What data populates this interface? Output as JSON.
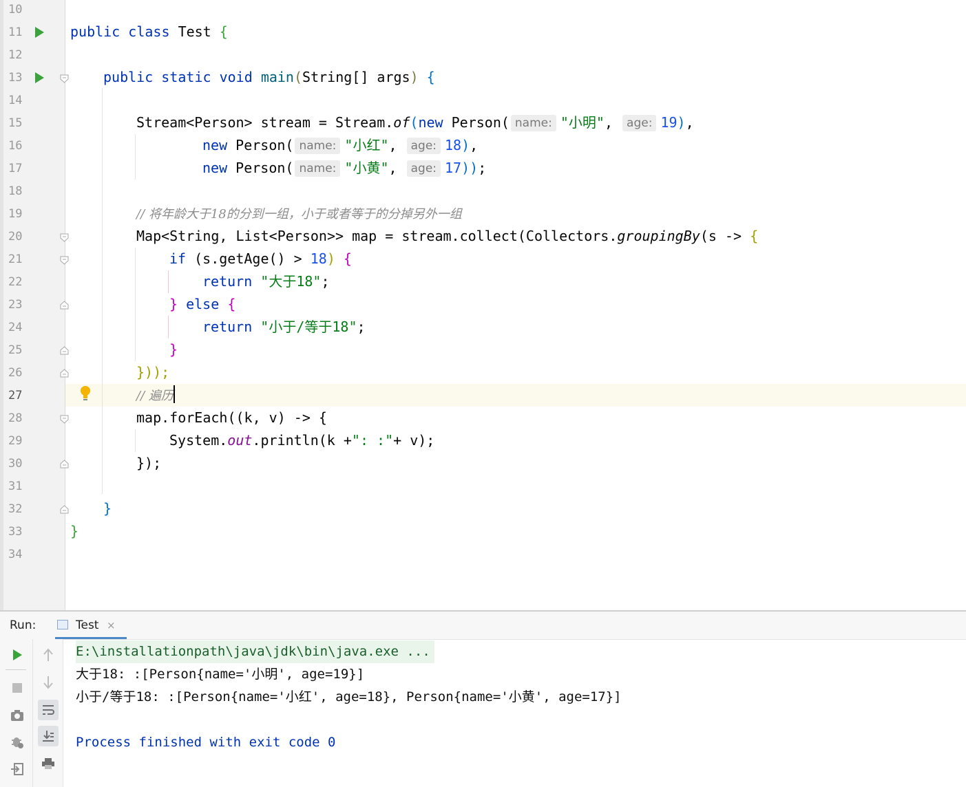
{
  "line_numbers": [
    "10",
    "11",
    "12",
    "13",
    "14",
    "15",
    "16",
    "17",
    "18",
    "19",
    "20",
    "21",
    "22",
    "23",
    "24",
    "25",
    "26",
    "27",
    "28",
    "29",
    "30",
    "31",
    "32",
    "33",
    "34"
  ],
  "current_line": "27",
  "code": {
    "class_kw1": "public",
    "class_kw2": "class",
    "class_name": "Test",
    "main_kw1": "public",
    "main_kw2": "static",
    "main_kw3": "void",
    "main_name": "main",
    "main_params": "String[] args",
    "stream_type": "Stream<Person>",
    "stream_var": "stream",
    "stream_of": "Stream.",
    "of": "of",
    "new": "new",
    "person": "Person(",
    "hint_name": "name:",
    "hint_age": "age:",
    "p1_name": "\"小明\"",
    "p1_age": "19",
    "p2_name": "\"小红\"",
    "p2_age": "18",
    "p3_name": "\"小黄\"",
    "p3_age": "17",
    "comment1": "// 将年龄大于18的分到一组，小于或者等于的分掉另外一组",
    "map_decl": "Map<String, List<Person>> map = stream.collect(Collectors.",
    "grouping": "groupingBy",
    "lambda_s": "(s -> ",
    "if_kw": "if",
    "if_cond": "(s.getAge() > ",
    "if_num": "18",
    "return_kw": "return",
    "ret1": "\"大于18\"",
    "else_kw": "else",
    "ret2": "\"小于/等于18\"",
    "close_collect": "}));",
    "comment2": "// 遍历",
    "foreach": "map.forEach((k, v) -> {",
    "println_a": "System.",
    "println_out": "out",
    "println_b": ".println(k +",
    "println_str": "\": :\"",
    "println_c": "+ v);",
    "close_foreach": "});",
    "close_brace": "}"
  },
  "run_panel": {
    "label": "Run:",
    "tab_label": "Test",
    "tab_close": "×",
    "console": [
      "E:\\installationpath\\java\\jdk\\bin\\java.exe ...",
      "大于18: :[Person{name='小明', age=19}]",
      "小于/等于18: :[Person{name='小红', age=18}, Person{name='小黄', age=17}]",
      "",
      "Process finished with exit code 0"
    ]
  },
  "colors": {
    "keyword": "#0033b3",
    "string": "#067d17",
    "number": "#1750eb",
    "comment": "#8c8c8c",
    "run_green": "#3ba33b"
  }
}
